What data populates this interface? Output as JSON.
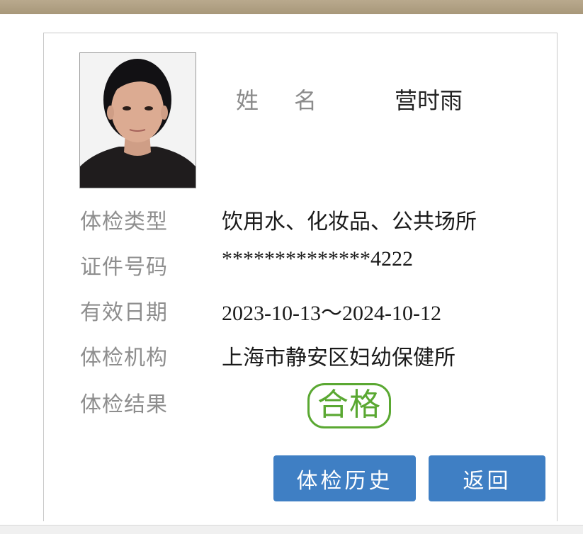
{
  "person": {
    "name_label_char1": "姓",
    "name_label_char2": "名",
    "name": "营时雨"
  },
  "fields": {
    "type_label": "体检类型",
    "type_value": "饮用水、化妆品、公共场所",
    "id_label": "证件号码",
    "id_value": "**************4222",
    "valid_label": "有效日期",
    "valid_value": "2023-10-13～2024-10-12",
    "org_label": "体检机构",
    "org_value": "上海市静安区妇幼保健所",
    "result_label": "体检结果",
    "result_value": "合格"
  },
  "buttons": {
    "history": "体检历史",
    "back": "返回"
  },
  "colors": {
    "button_bg": "#3f7fc4",
    "stamp_green": "#5aa832",
    "top_band": "#b09f82"
  }
}
